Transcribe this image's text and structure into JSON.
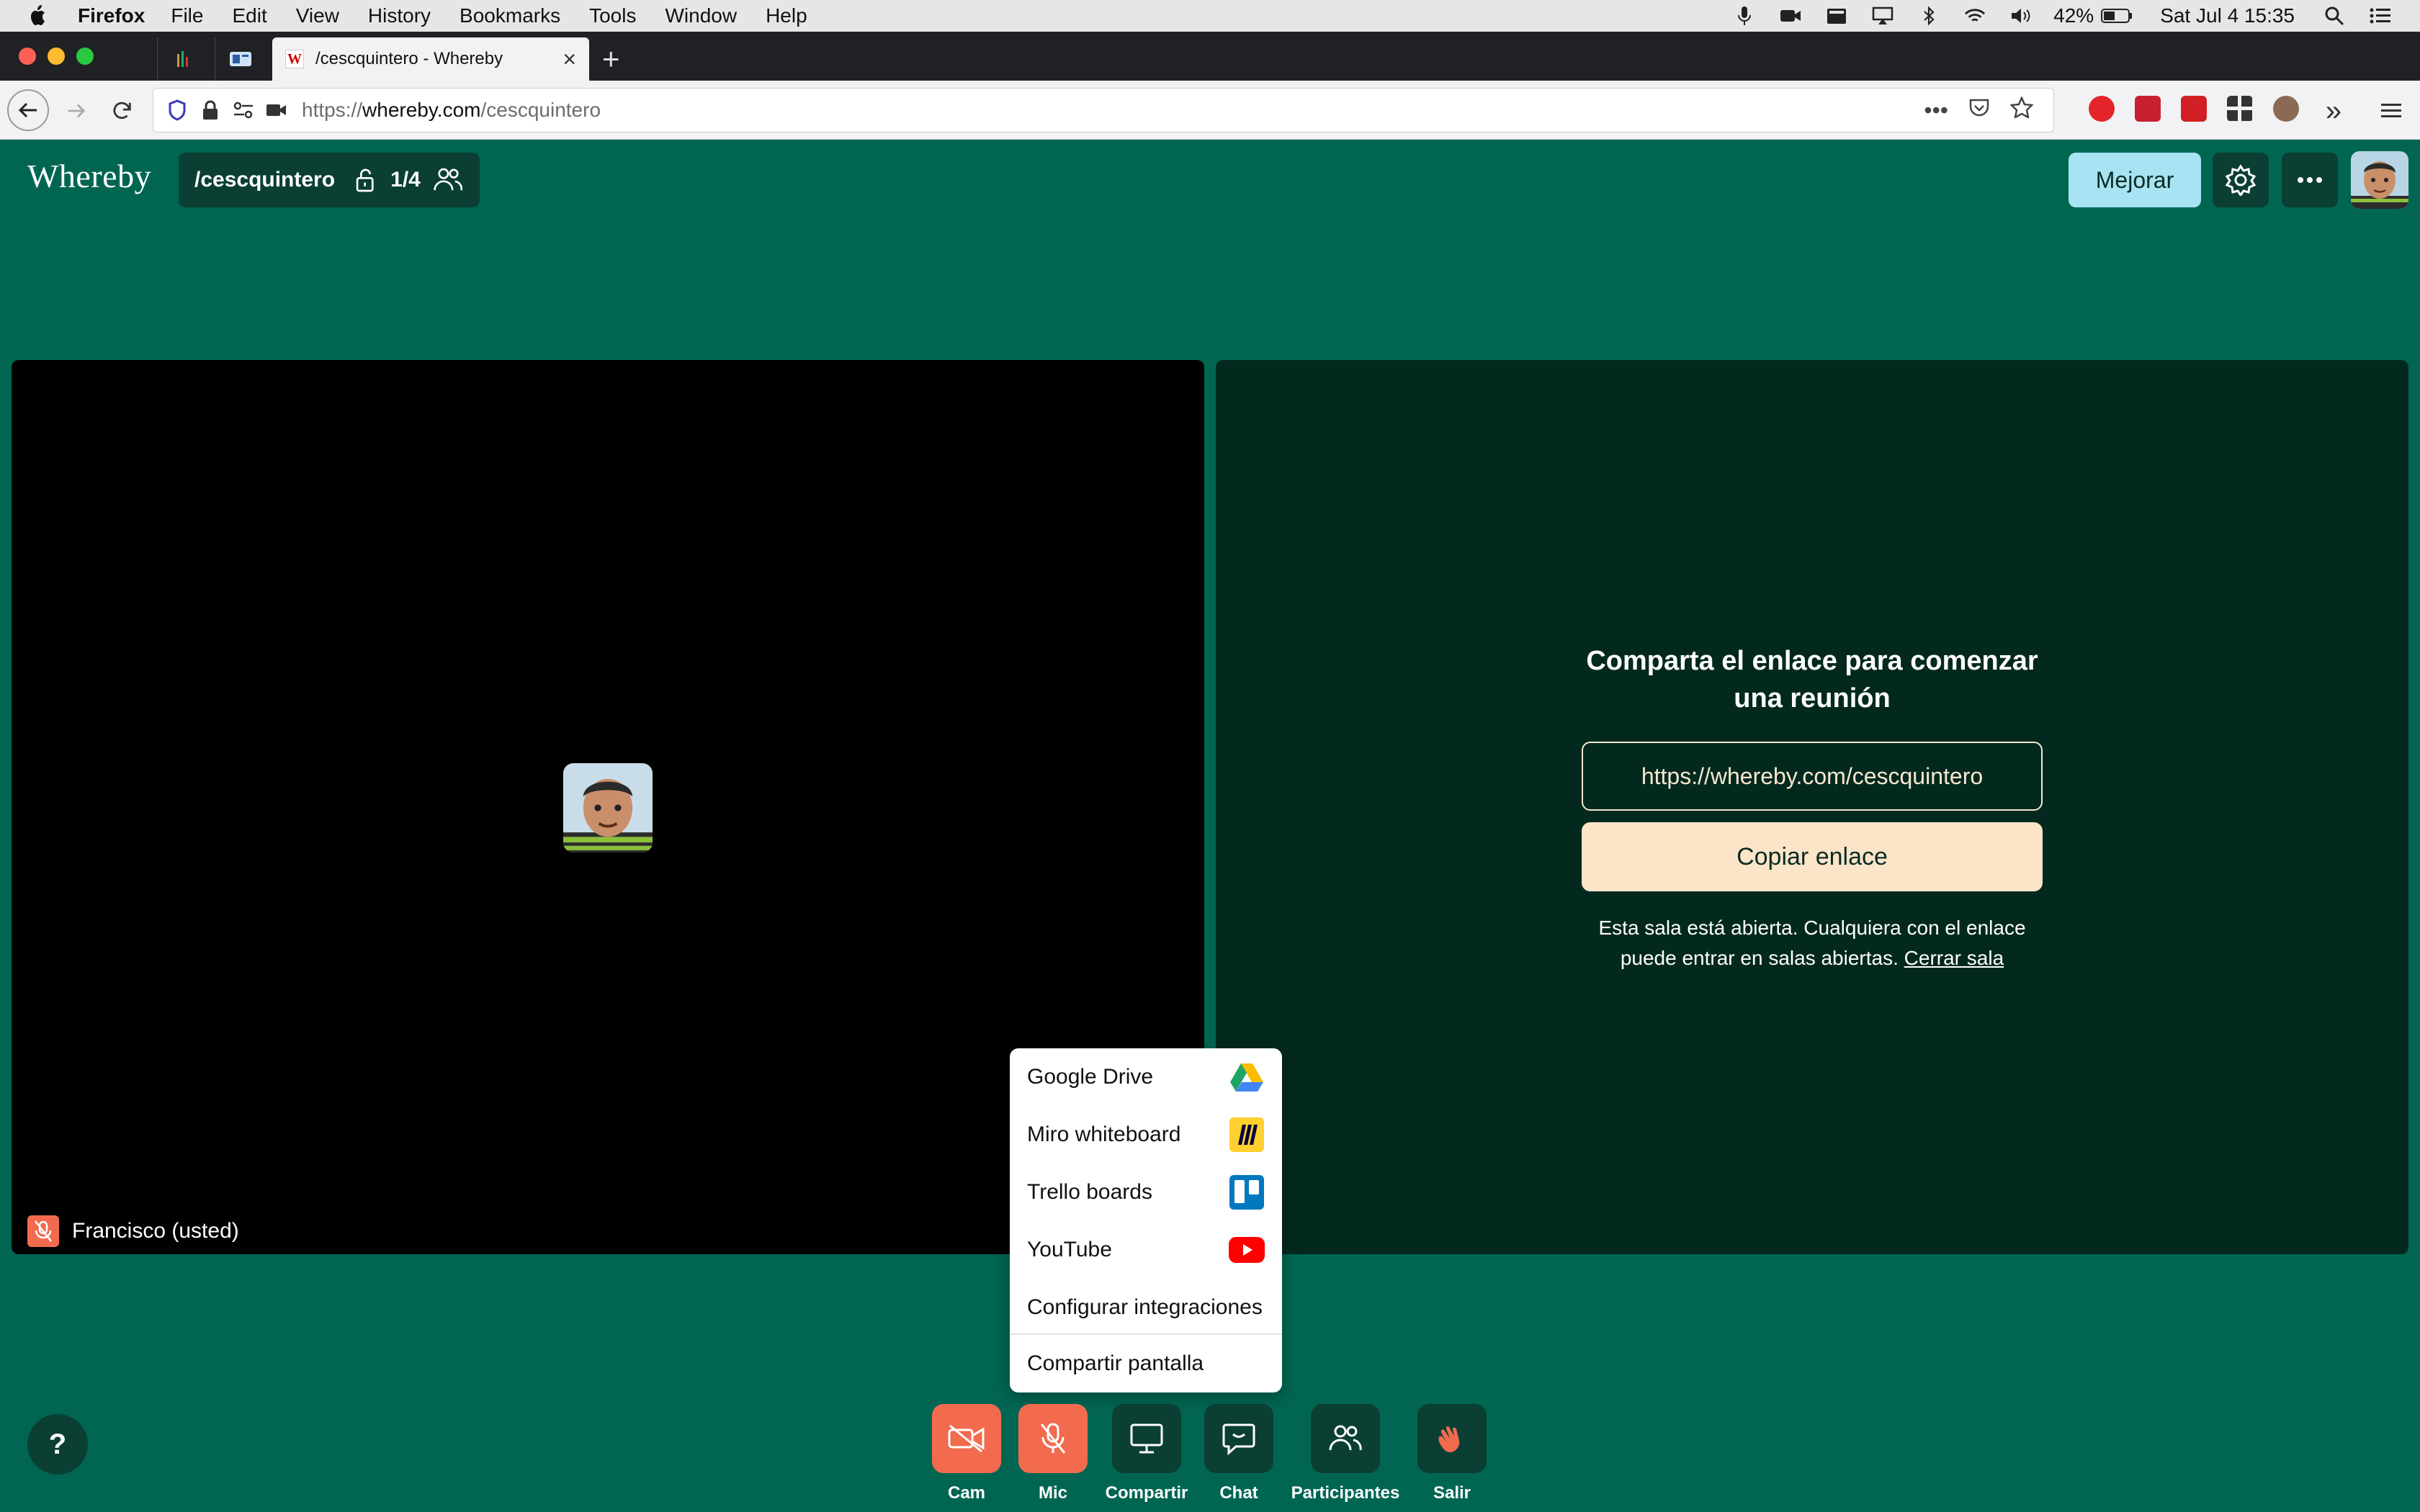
{
  "menubar": {
    "app": "Firefox",
    "items": [
      "File",
      "Edit",
      "View",
      "History",
      "Bookmarks",
      "Tools",
      "Window",
      "Help"
    ],
    "battery": "42%",
    "clock": "Sat Jul 4  15:35"
  },
  "browser": {
    "tab_title": "/cescquintero - Whereby",
    "url_proto": "https://",
    "url_host": "whereby.com",
    "url_path": "/cescquintero"
  },
  "header": {
    "logo": "Whereby",
    "room": "/cescquintero",
    "count": "1/4",
    "upgrade": "Mejorar"
  },
  "video": {
    "self_name": "Francisco (usted)"
  },
  "share": {
    "title": "Comparta el enlace para comenzar una reunión",
    "link": "https://whereby.com/cescquintero",
    "copy": "Copiar enlace",
    "note": "Esta sala está abierta. Cualquiera con el enlace puede entrar en salas abiertas.",
    "close_link": "Cerrar sala"
  },
  "share_menu": {
    "items": [
      "Google Drive",
      "Miro whiteboard",
      "Trello boards",
      "YouTube",
      "Configurar integraciones"
    ],
    "screen": "Compartir pantalla"
  },
  "toolbar": {
    "cam": "Cam",
    "mic": "Mic",
    "share": "Compartir",
    "chat": "Chat",
    "people": "Participantes",
    "leave": "Salir"
  },
  "help": "?",
  "colors": {
    "background": "#006652",
    "panel": "#03291f",
    "accent_red": "#f26b4f",
    "upgrade": "#a7e3f2",
    "copy_button": "#fbe4c8"
  }
}
